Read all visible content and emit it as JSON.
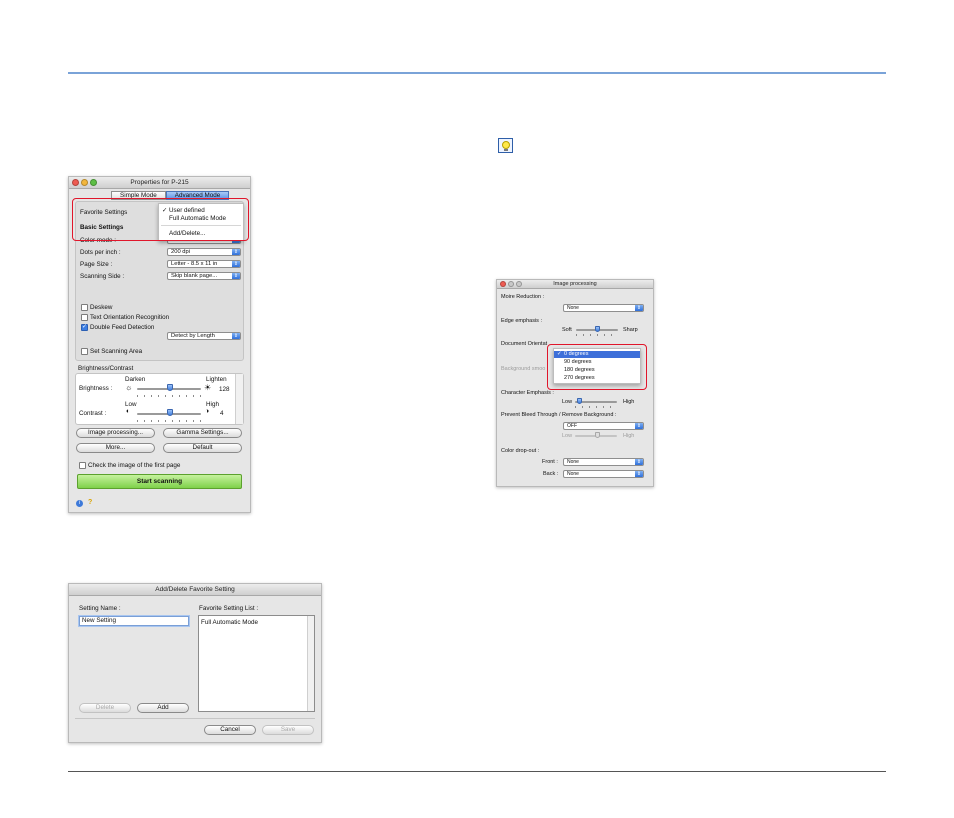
{
  "properties_window": {
    "title": "Properties for P-215",
    "tabs": [
      "Simple Mode",
      "Advanced Mode"
    ],
    "favorite_settings_label": "Favorite Settings",
    "favorite_menu": [
      "User defined",
      "Full Automatic Mode",
      "Add/Delete..."
    ],
    "basic_settings_label": "Basic Settings",
    "color_mode_label": "Color mode :",
    "color_mode_value": "Black and White",
    "dpi_label": "Dots per inch :",
    "dpi_value": "200 dpi",
    "page_size_label": "Page Size :",
    "page_size_value": "Letter - 8.5 x 11 in",
    "scanning_side_label": "Scanning Side :",
    "scanning_side_value": "Skip blank page...",
    "deskew_label": "Deskew",
    "text_orientation_label": "Text Orientation Recognition",
    "double_feed_label": "Double Feed Detection",
    "double_feed_value": "Detect by Length",
    "set_area_label": "Set Scanning Area",
    "brightness_contrast_label": "Brightness/Contrast",
    "darken_label": "Darken",
    "lighten_label": "Lighten",
    "brightness_label": "Brightness :",
    "brightness_value": "128",
    "low_label": "Low",
    "high_label": "High",
    "contrast_label": "Contrast :",
    "contrast_value": "4",
    "image_processing_button": "Image processing...",
    "gamma_button": "Gamma Settings...",
    "more_button": "More...",
    "default_button": "Default",
    "check_first_page_label": "Check the image of the first page",
    "start_button": "Start scanning",
    "footer_info": "i",
    "footer_help": "?"
  },
  "add_delete_window": {
    "title": "Add/Delete Favorite Setting",
    "setting_name_label": "Setting Name :",
    "setting_name_value": "New Setting",
    "favorite_list_label": "Favorite Setting List :",
    "favorite_list": [
      "Full Automatic Mode"
    ],
    "delete_button": "Delete",
    "add_button": "Add",
    "cancel_button": "Cancel",
    "save_button": "Save"
  },
  "image_processing_window": {
    "title": "Image processing",
    "moire_label": "Moire Reduction :",
    "moire_value": "None",
    "edge_label": "Edge emphasis :",
    "soft_label": "Soft",
    "sharp_label": "Sharp",
    "doc_orientation_label": "Document Orientat",
    "orientation_menu": [
      "0 degrees",
      "90 degrees",
      "180 degrees",
      "270 degrees"
    ],
    "background_smooth_label": "Background smoo",
    "char_emphasis_label": "Character Emphasis :",
    "char_low_label": "Low",
    "char_high_label": "High",
    "bleed_label": "Prevent Bleed Through / Remove Background :",
    "bleed_value": "OFF",
    "bleed_low_label": "Low",
    "bleed_high_label": "High",
    "color_dropout_label": "Color drop-out :",
    "front_label": "Front :",
    "front_value": "None",
    "back_label": "Back :",
    "back_value": "None"
  }
}
